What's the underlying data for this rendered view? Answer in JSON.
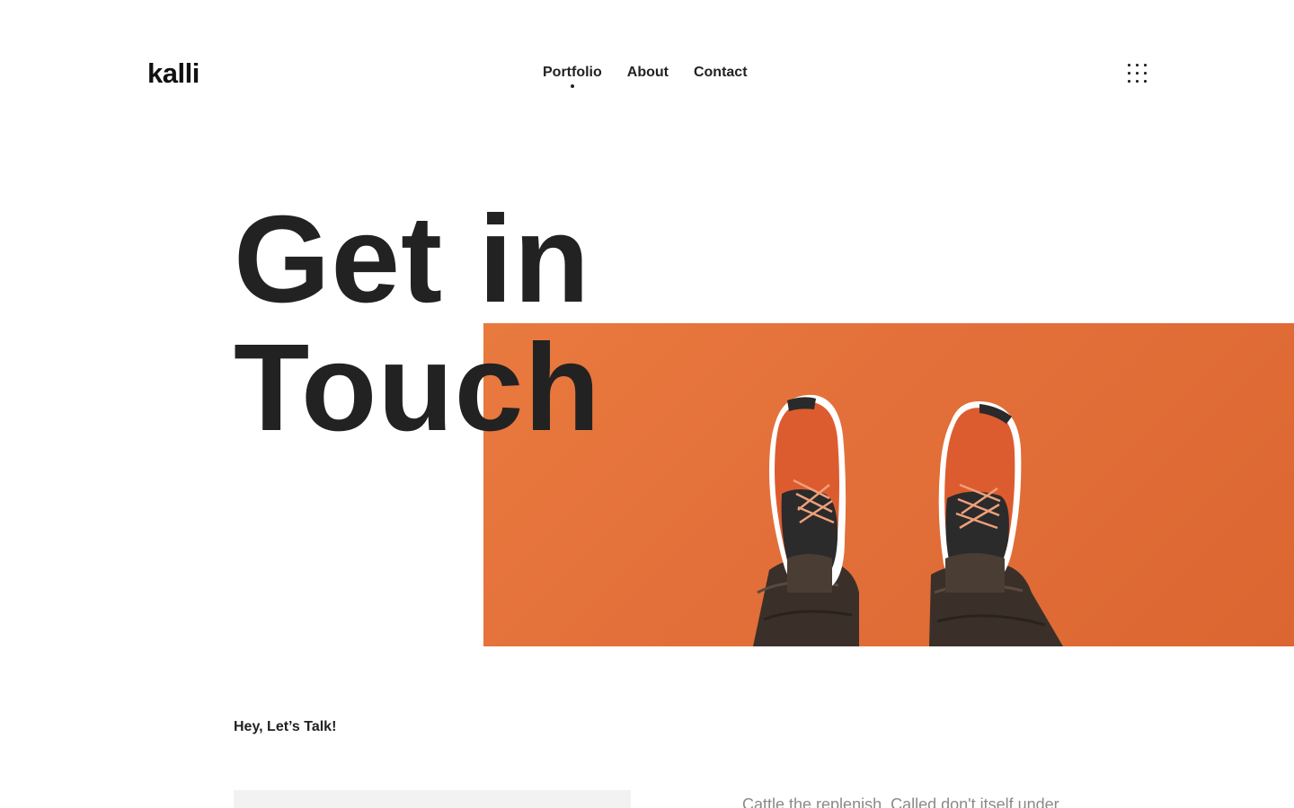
{
  "brand": {
    "logo": "kalli"
  },
  "nav": {
    "items": [
      {
        "label": "Portfolio",
        "active": true
      },
      {
        "label": "About",
        "active": false
      },
      {
        "label": "Contact",
        "active": false
      }
    ],
    "menu_icon": "grid-dots-icon"
  },
  "hero": {
    "headline_line1": "Get in",
    "headline_line2": "Touch",
    "photo_description_icon": "sneakers-photo",
    "photo_bg_color": "#e3703a"
  },
  "contact": {
    "intro": "Hey, Let’s Talk!",
    "body": "Cattle the replenish. Called don't itself under",
    "field_value": ""
  },
  "colors": {
    "text": "#222222",
    "muted": "#8a8a8a",
    "accent": "#e3703a",
    "field_bg": "#f2f2f2"
  }
}
